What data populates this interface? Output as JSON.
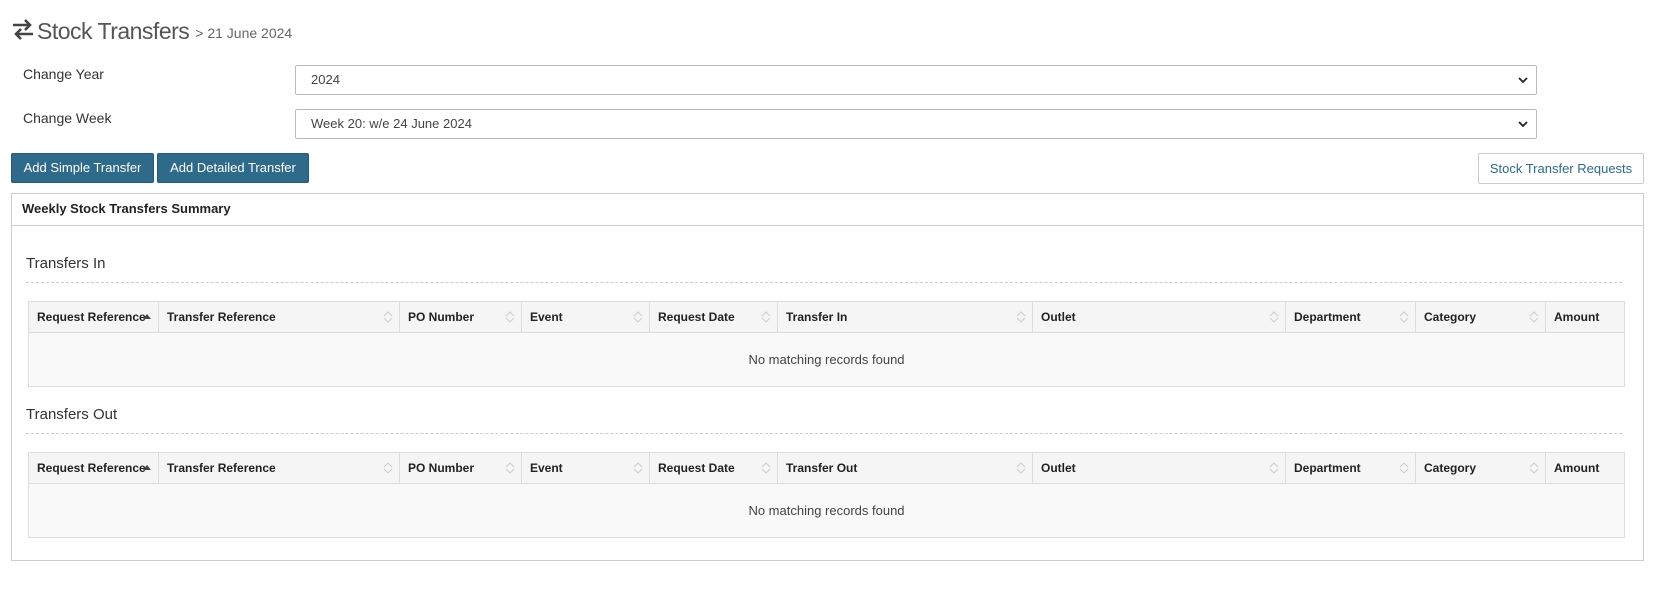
{
  "header": {
    "title": "Stock Transfers",
    "breadcrumb": "> 21 June 2024"
  },
  "filters": {
    "year": {
      "label": "Change Year",
      "selected": "2024"
    },
    "week": {
      "label": "Change Week",
      "selected": "Week 20: w/e 24 June 2024"
    }
  },
  "actions": {
    "add_simple": "Add Simple Transfer",
    "add_detailed": "Add Detailed Transfer",
    "requests": "Stock Transfer Requests"
  },
  "panel": {
    "heading": "Weekly Stock Transfers Summary",
    "transfers_in": {
      "title": "Transfers In",
      "columns": [
        "Request Reference",
        "Transfer Reference",
        "PO Number",
        "Event",
        "Request Date",
        "Transfer In",
        "Outlet",
        "Department",
        "Category",
        "Amount"
      ],
      "empty_message": "No matching records found"
    },
    "transfers_out": {
      "title": "Transfers Out",
      "columns": [
        "Request Reference",
        "Transfer Reference",
        "PO Number",
        "Event",
        "Request Date",
        "Transfer Out",
        "Outlet",
        "Department",
        "Category",
        "Amount"
      ],
      "empty_message": "No matching records found"
    }
  },
  "colors": {
    "primary": "#2e6a8a",
    "border": "#cccccc"
  },
  "icons": {
    "header": "swap-arrows-icon",
    "sort_active": "sort-up-icon",
    "sort_inactive": "sort-both-icon",
    "select": "chevron-down-icon"
  }
}
